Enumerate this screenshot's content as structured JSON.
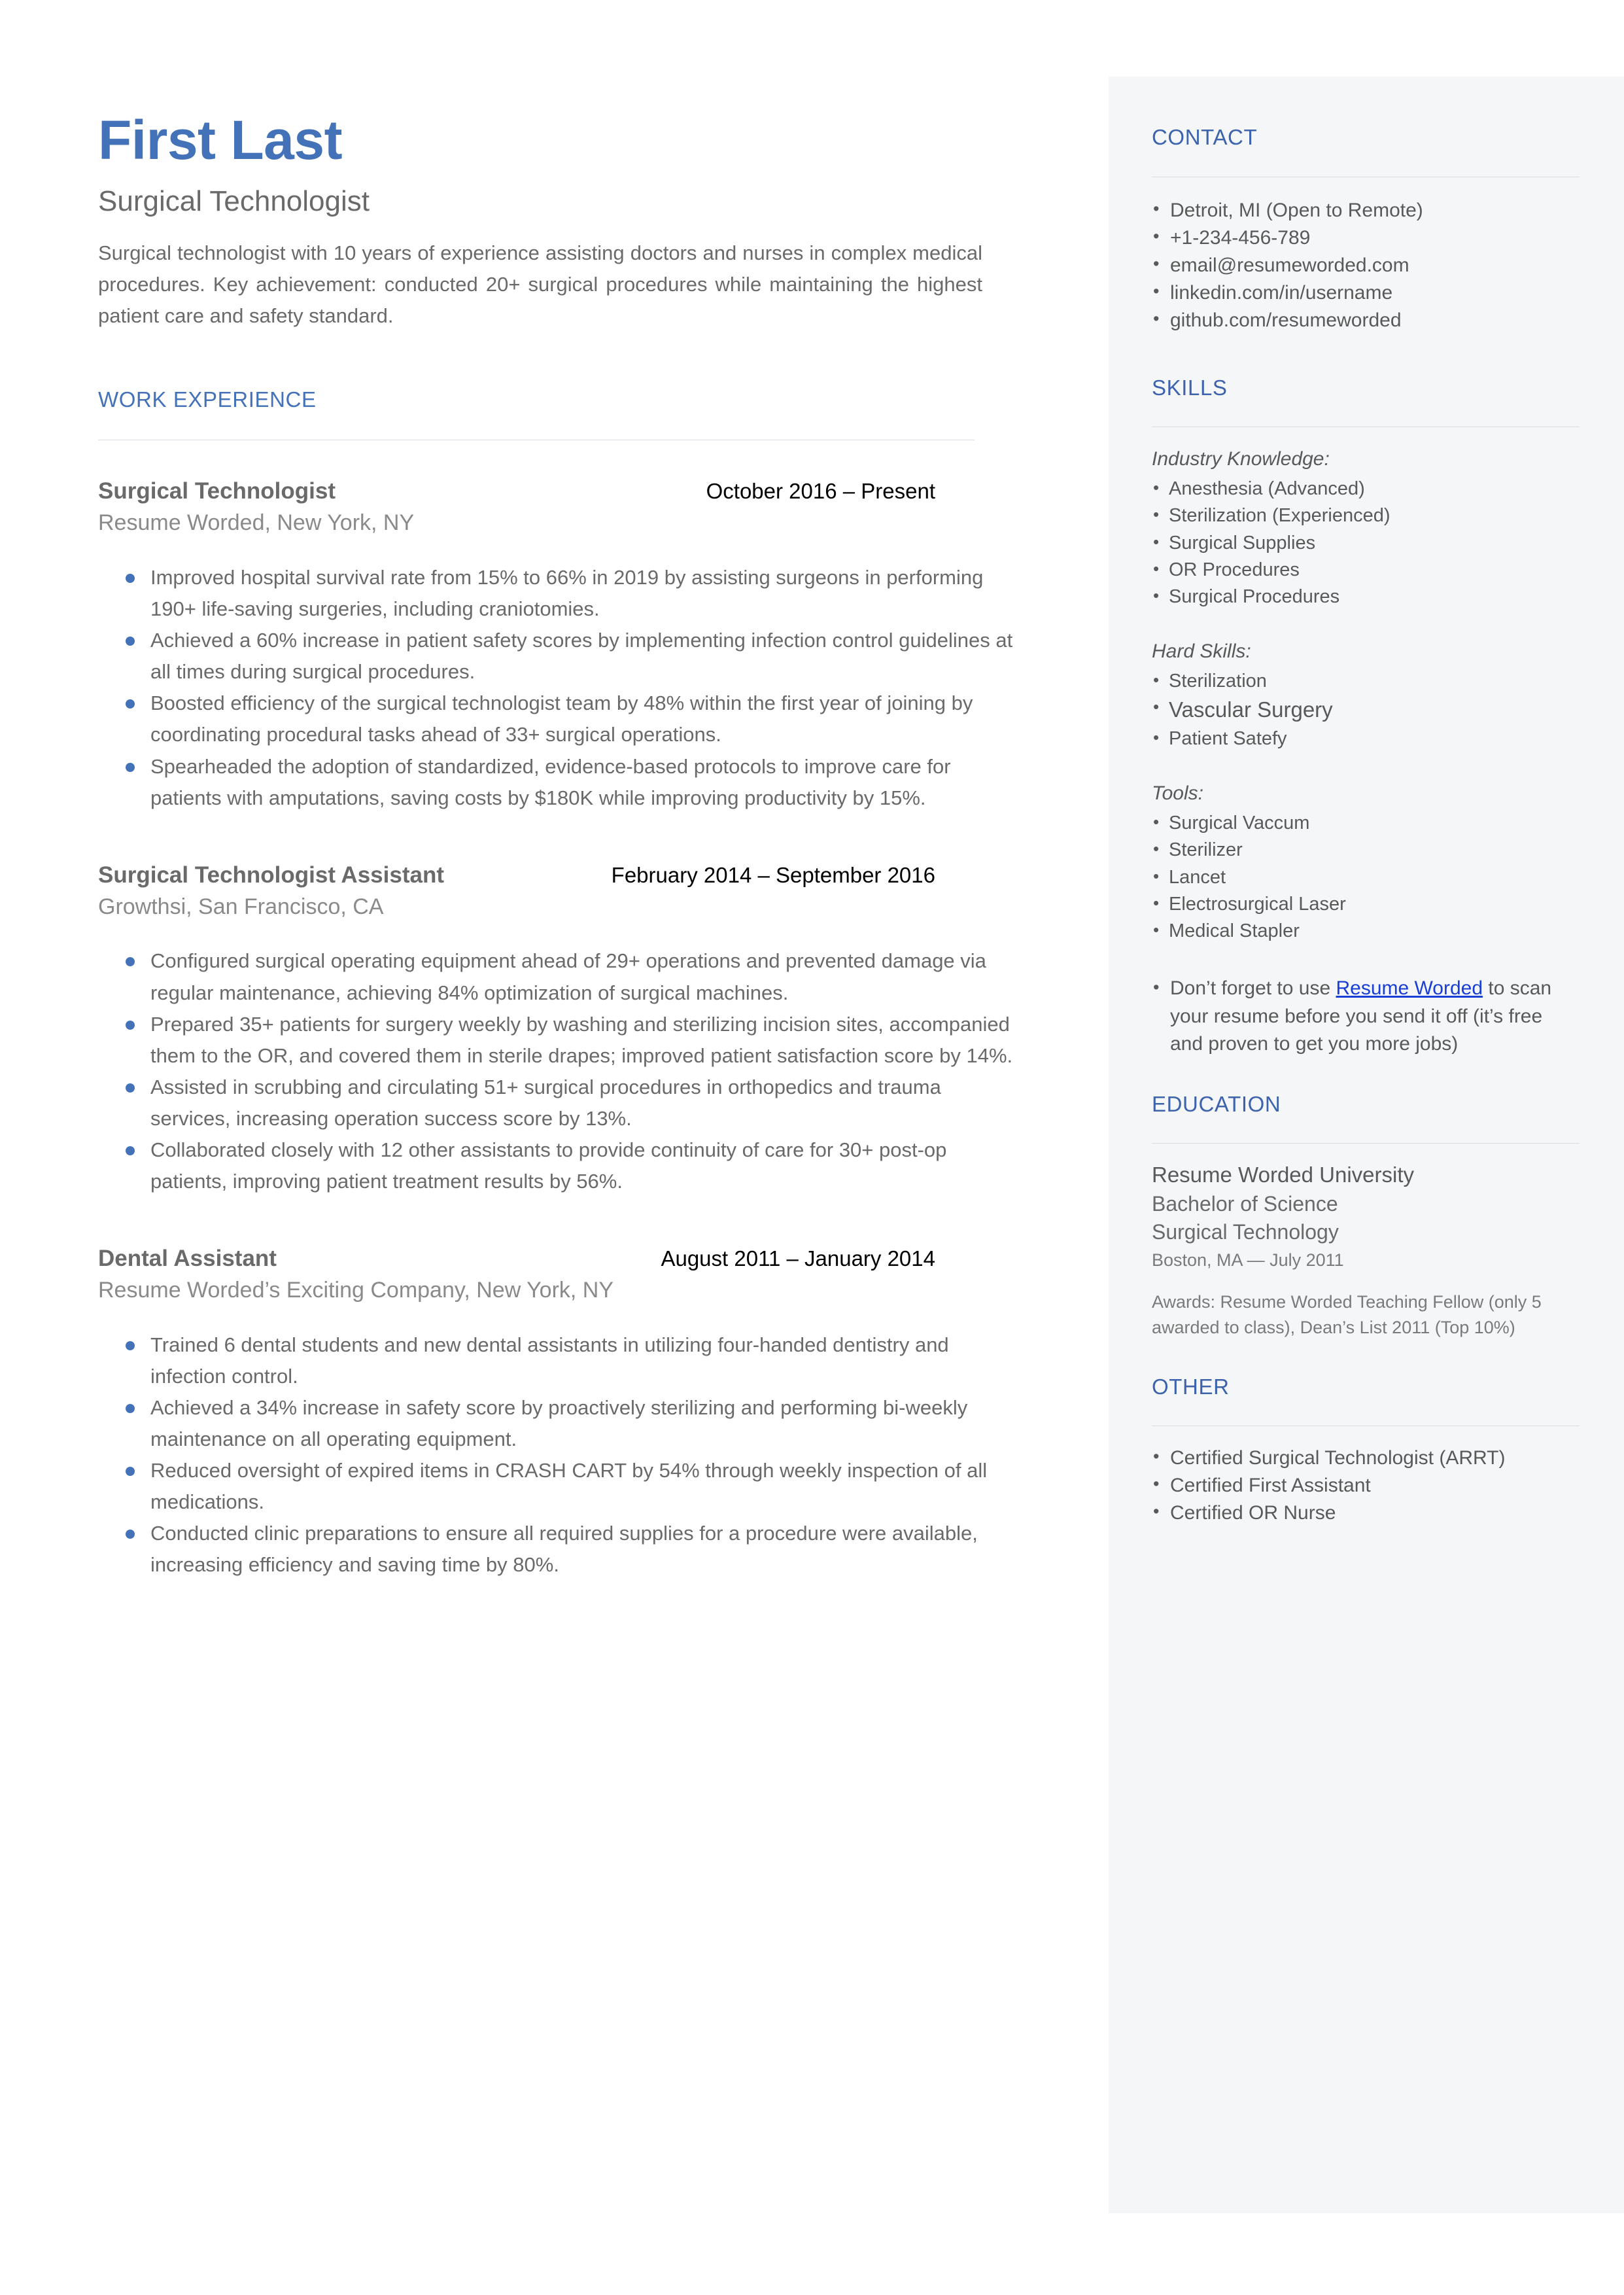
{
  "header": {
    "name": "First Last",
    "title": "Surgical Technologist",
    "summary": "Surgical technologist with 10 years of experience assisting doctors and nurses in complex medical procedures. Key achievement: conducted 20+ surgical procedures while maintaining the highest patient care and safety standard."
  },
  "work": {
    "heading": "WORK EXPERIENCE",
    "jobs": [
      {
        "role": "Surgical Technologist",
        "dates": "October 2016 – Present",
        "company": "Resume Worded, New York, NY",
        "bullets": [
          "Improved hospital survival rate from 15% to 66% in 2019 by assisting surgeons in performing 190+ life-saving surgeries, including craniotomies.",
          "Achieved a 60% increase in patient safety scores by implementing infection control guidelines at all times during surgical procedures.",
          "Boosted efficiency of the surgical technologist team by 48% within the first year of joining by coordinating procedural tasks ahead of 33+ surgical operations.",
          "Spearheaded the adoption of standardized, evidence-based protocols to improve care for patients with amputations, saving costs by $180K while improving productivity by 15%."
        ]
      },
      {
        "role": "Surgical Technologist Assistant",
        "dates": "February 2014 – September 2016",
        "company": "Growthsi, San Francisco, CA",
        "bullets": [
          "Configured surgical operating equipment ahead of 29+ operations and prevented damage via regular maintenance, achieving 84% optimization of surgical machines.",
          "Prepared 35+ patients for surgery weekly by washing and sterilizing incision sites, accompanied them to the OR, and covered them in sterile drapes; improved patient satisfaction score by 14%.",
          "Assisted in scrubbing and circulating 51+ surgical procedures in orthopedics and trauma services, increasing operation success score by 13%.",
          "Collaborated closely with 12 other assistants to provide continuity of care for 30+ post-op patients, improving patient treatment results by 56%."
        ]
      },
      {
        "role": "Dental Assistant",
        "dates": "August 2011 – January 2014",
        "company": "Resume Worded’s Exciting Company, New York, NY",
        "bullets": [
          "Trained 6 dental students and new dental assistants in utilizing four-handed dentistry and infection control.",
          "Achieved a 34% increase in safety score by proactively sterilizing and performing bi-weekly maintenance on all operating equipment.",
          "Reduced oversight of expired items in CRASH CART by 54% through weekly inspection of all medications.",
          "Conducted clinic preparations to ensure all required supplies for a procedure were available, increasing efficiency and saving time by 80%."
        ]
      }
    ]
  },
  "sidebar": {
    "contact": {
      "heading": "CONTACT",
      "items": [
        " Detroit, MI (Open to Remote)",
        "+1-234-456-789",
        "email@resumeworded.com",
        "linkedin.com/in/username",
        "github.com/resumeworded"
      ]
    },
    "skills": {
      "heading": "SKILLS",
      "groups": [
        {
          "label": "Industry Knowledge:",
          "items": [
            "Anesthesia (Advanced)",
            "Sterilization (Experienced)",
            "Surgical Supplies",
            "OR Procedures",
            "Surgical Procedures"
          ]
        },
        {
          "label": "Hard Skills:",
          "items": [
            "Sterilization",
            "Vascular Surgery",
            "Patient Satefy"
          ]
        },
        {
          "label": "Tools:",
          "items": [
            "Surgical Vaccum",
            "Sterilizer",
            "Lancet",
            "Electrosurgical Laser",
            "Medical Stapler"
          ]
        }
      ],
      "promo": {
        "before": " Don’t forget to use ",
        "link": "Resume Worded",
        "after": " to scan your resume before you send it off (it’s free and proven to get you more jobs)"
      }
    },
    "education": {
      "heading": "EDUCATION",
      "school": "Resume Worded University",
      "degree": "Bachelor of Science",
      "field": "Surgical Technology",
      "location": "Boston, MA — July 2011",
      "awards": "Awards: Resume Worded Teaching Fellow (only 5 awarded to class), Dean’s List 2011 (Top 10%)"
    },
    "other": {
      "heading": "OTHER",
      "items": [
        " Certified Surgical Technologist (ARRT)",
        "Certified First Assistant",
        "Certified OR Nurse"
      ]
    }
  },
  "colors": {
    "accent_blue": "#4472b8",
    "heading_blue": "#3c63ab",
    "link_blue": "#1a3fd4",
    "sidebar_bg": "#f4f6f8",
    "body_text": "#6a6a6a"
  }
}
